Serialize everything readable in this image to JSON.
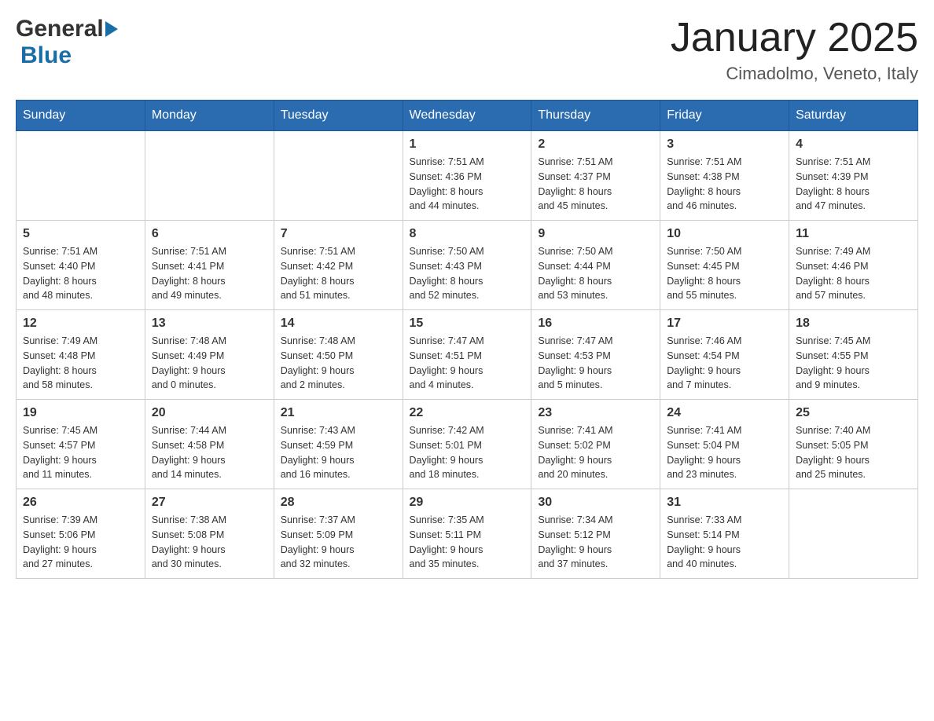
{
  "header": {
    "logo_general": "General",
    "logo_blue": "Blue",
    "month_title": "January 2025",
    "location": "Cimadolmo, Veneto, Italy"
  },
  "days_of_week": [
    "Sunday",
    "Monday",
    "Tuesday",
    "Wednesday",
    "Thursday",
    "Friday",
    "Saturday"
  ],
  "weeks": [
    [
      {
        "day": "",
        "info": ""
      },
      {
        "day": "",
        "info": ""
      },
      {
        "day": "",
        "info": ""
      },
      {
        "day": "1",
        "info": "Sunrise: 7:51 AM\nSunset: 4:36 PM\nDaylight: 8 hours\nand 44 minutes."
      },
      {
        "day": "2",
        "info": "Sunrise: 7:51 AM\nSunset: 4:37 PM\nDaylight: 8 hours\nand 45 minutes."
      },
      {
        "day": "3",
        "info": "Sunrise: 7:51 AM\nSunset: 4:38 PM\nDaylight: 8 hours\nand 46 minutes."
      },
      {
        "day": "4",
        "info": "Sunrise: 7:51 AM\nSunset: 4:39 PM\nDaylight: 8 hours\nand 47 minutes."
      }
    ],
    [
      {
        "day": "5",
        "info": "Sunrise: 7:51 AM\nSunset: 4:40 PM\nDaylight: 8 hours\nand 48 minutes."
      },
      {
        "day": "6",
        "info": "Sunrise: 7:51 AM\nSunset: 4:41 PM\nDaylight: 8 hours\nand 49 minutes."
      },
      {
        "day": "7",
        "info": "Sunrise: 7:51 AM\nSunset: 4:42 PM\nDaylight: 8 hours\nand 51 minutes."
      },
      {
        "day": "8",
        "info": "Sunrise: 7:50 AM\nSunset: 4:43 PM\nDaylight: 8 hours\nand 52 minutes."
      },
      {
        "day": "9",
        "info": "Sunrise: 7:50 AM\nSunset: 4:44 PM\nDaylight: 8 hours\nand 53 minutes."
      },
      {
        "day": "10",
        "info": "Sunrise: 7:50 AM\nSunset: 4:45 PM\nDaylight: 8 hours\nand 55 minutes."
      },
      {
        "day": "11",
        "info": "Sunrise: 7:49 AM\nSunset: 4:46 PM\nDaylight: 8 hours\nand 57 minutes."
      }
    ],
    [
      {
        "day": "12",
        "info": "Sunrise: 7:49 AM\nSunset: 4:48 PM\nDaylight: 8 hours\nand 58 minutes."
      },
      {
        "day": "13",
        "info": "Sunrise: 7:48 AM\nSunset: 4:49 PM\nDaylight: 9 hours\nand 0 minutes."
      },
      {
        "day": "14",
        "info": "Sunrise: 7:48 AM\nSunset: 4:50 PM\nDaylight: 9 hours\nand 2 minutes."
      },
      {
        "day": "15",
        "info": "Sunrise: 7:47 AM\nSunset: 4:51 PM\nDaylight: 9 hours\nand 4 minutes."
      },
      {
        "day": "16",
        "info": "Sunrise: 7:47 AM\nSunset: 4:53 PM\nDaylight: 9 hours\nand 5 minutes."
      },
      {
        "day": "17",
        "info": "Sunrise: 7:46 AM\nSunset: 4:54 PM\nDaylight: 9 hours\nand 7 minutes."
      },
      {
        "day": "18",
        "info": "Sunrise: 7:45 AM\nSunset: 4:55 PM\nDaylight: 9 hours\nand 9 minutes."
      }
    ],
    [
      {
        "day": "19",
        "info": "Sunrise: 7:45 AM\nSunset: 4:57 PM\nDaylight: 9 hours\nand 11 minutes."
      },
      {
        "day": "20",
        "info": "Sunrise: 7:44 AM\nSunset: 4:58 PM\nDaylight: 9 hours\nand 14 minutes."
      },
      {
        "day": "21",
        "info": "Sunrise: 7:43 AM\nSunset: 4:59 PM\nDaylight: 9 hours\nand 16 minutes."
      },
      {
        "day": "22",
        "info": "Sunrise: 7:42 AM\nSunset: 5:01 PM\nDaylight: 9 hours\nand 18 minutes."
      },
      {
        "day": "23",
        "info": "Sunrise: 7:41 AM\nSunset: 5:02 PM\nDaylight: 9 hours\nand 20 minutes."
      },
      {
        "day": "24",
        "info": "Sunrise: 7:41 AM\nSunset: 5:04 PM\nDaylight: 9 hours\nand 23 minutes."
      },
      {
        "day": "25",
        "info": "Sunrise: 7:40 AM\nSunset: 5:05 PM\nDaylight: 9 hours\nand 25 minutes."
      }
    ],
    [
      {
        "day": "26",
        "info": "Sunrise: 7:39 AM\nSunset: 5:06 PM\nDaylight: 9 hours\nand 27 minutes."
      },
      {
        "day": "27",
        "info": "Sunrise: 7:38 AM\nSunset: 5:08 PM\nDaylight: 9 hours\nand 30 minutes."
      },
      {
        "day": "28",
        "info": "Sunrise: 7:37 AM\nSunset: 5:09 PM\nDaylight: 9 hours\nand 32 minutes."
      },
      {
        "day": "29",
        "info": "Sunrise: 7:35 AM\nSunset: 5:11 PM\nDaylight: 9 hours\nand 35 minutes."
      },
      {
        "day": "30",
        "info": "Sunrise: 7:34 AM\nSunset: 5:12 PM\nDaylight: 9 hours\nand 37 minutes."
      },
      {
        "day": "31",
        "info": "Sunrise: 7:33 AM\nSunset: 5:14 PM\nDaylight: 9 hours\nand 40 minutes."
      },
      {
        "day": "",
        "info": ""
      }
    ]
  ]
}
